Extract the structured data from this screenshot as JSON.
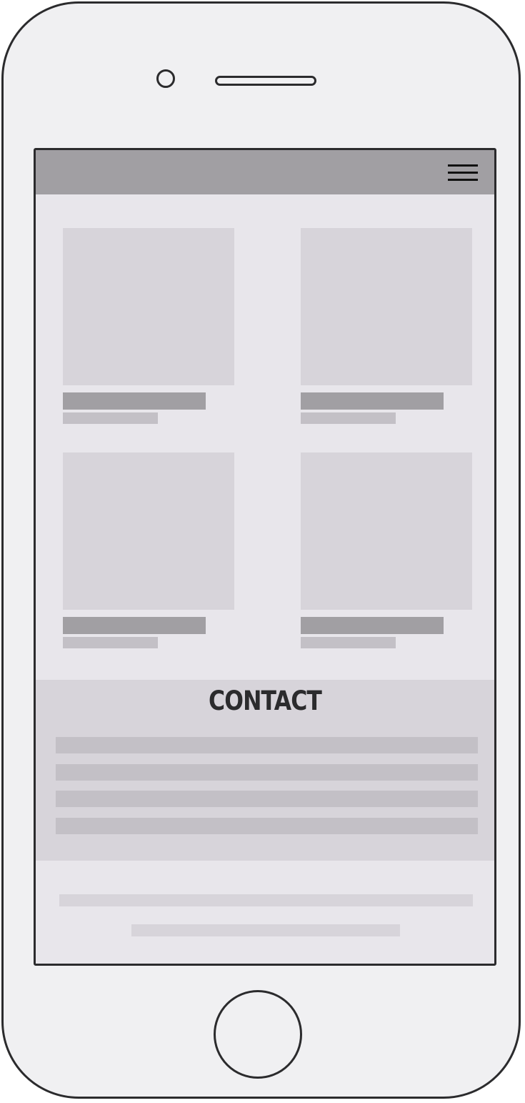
{
  "screen": {
    "topbar": {
      "menu_icon": "hamburger-menu-icon"
    },
    "products": [
      {
        "id": 1
      },
      {
        "id": 2
      },
      {
        "id": 3
      },
      {
        "id": 4
      }
    ],
    "contact": {
      "title": "CONTACT",
      "fields": 4
    }
  },
  "colors": {
    "device_body": "#f0f0f2",
    "outline": "#2b2b2d",
    "topbar": "#a19fa3",
    "screen_bg": "#e8e6eb",
    "placeholder_light": "#d7d4da",
    "placeholder_mid": "#c3c0c6"
  }
}
